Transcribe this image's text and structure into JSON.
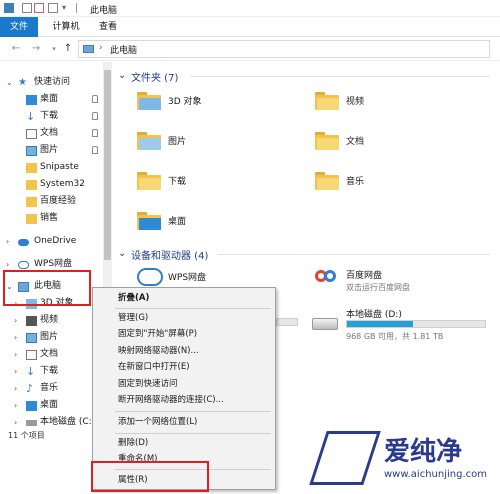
{
  "window": {
    "title": "此电脑"
  },
  "ribbon": {
    "tabs": [
      "文件",
      "计算机",
      "查看"
    ]
  },
  "address": {
    "path": "此电脑"
  },
  "nav": {
    "quick_access": "快速访问",
    "quick_items": [
      "桌面",
      "下载",
      "文档",
      "图片",
      "Snipaste",
      "System32",
      "百度经验",
      "销售"
    ],
    "onedrive": "OneDrive",
    "wps": "WPS网盘",
    "this_pc": "此电脑",
    "pc_items": [
      "3D 对象",
      "视频",
      "图片",
      "文档",
      "下载",
      "音乐",
      "桌面",
      "本地磁盘 (C:)"
    ],
    "status": "11 个项目"
  },
  "content": {
    "folders_header": "文件夹 (7)",
    "folders": [
      "3D 对象",
      "视频",
      "图片",
      "文档",
      "下载",
      "音乐",
      "桌面"
    ],
    "devices_header": "设备和驱动器 (4)",
    "wps_drive": "WPS网盘",
    "baidu_drive": "百度网盘",
    "baidu_sub": "双击运行百度网盘",
    "local_disk": "本地磁盘 (D:)",
    "local_disk_space": "968 GB 可用，共 1.81 TB",
    "local_disk_used_fraction": 0.48
  },
  "context_menu": {
    "items": [
      "折叠(A)",
      "管理(G)",
      "固定到\"开始\"屏幕(P)",
      "映射网络驱动器(N)...",
      "在新窗口中打开(E)",
      "固定到快速访问",
      "断开网络驱动器的连接(C)...",
      "添加一个网络位置(L)",
      "删除(D)",
      "重命名(M)",
      "属性(R)"
    ]
  },
  "watermark": {
    "brand": "爱纯净",
    "url": "www.aichunjing.com"
  },
  "colors": {
    "accent": "#1979ca",
    "highlight_box": "#e02020",
    "folder": "#f3c44c"
  }
}
